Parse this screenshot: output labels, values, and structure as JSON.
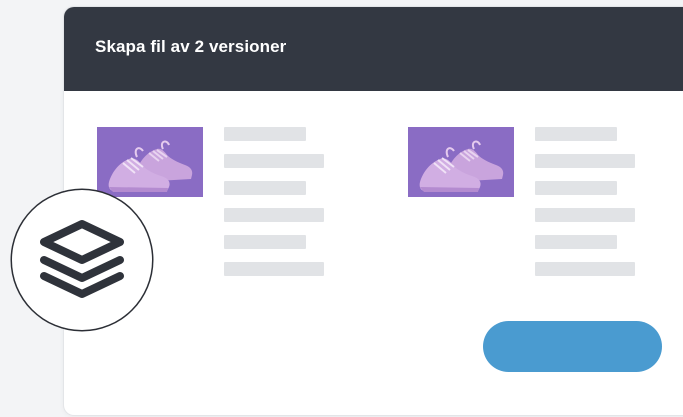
{
  "dialog": {
    "title": "Skapa fil av 2 versioner"
  },
  "versions": [
    {
      "thumbnail": "purple-sneakers-image"
    },
    {
      "thumbnail": "purple-sneakers-image"
    }
  ],
  "badge": {
    "icon": "layers-icon"
  },
  "colors": {
    "header": "#333842",
    "button": "#4a9bd0",
    "thumbnail_bg": "#8a6cc4",
    "placeholder": "#e1e3e6",
    "page_bg": "#f3f4f6"
  }
}
